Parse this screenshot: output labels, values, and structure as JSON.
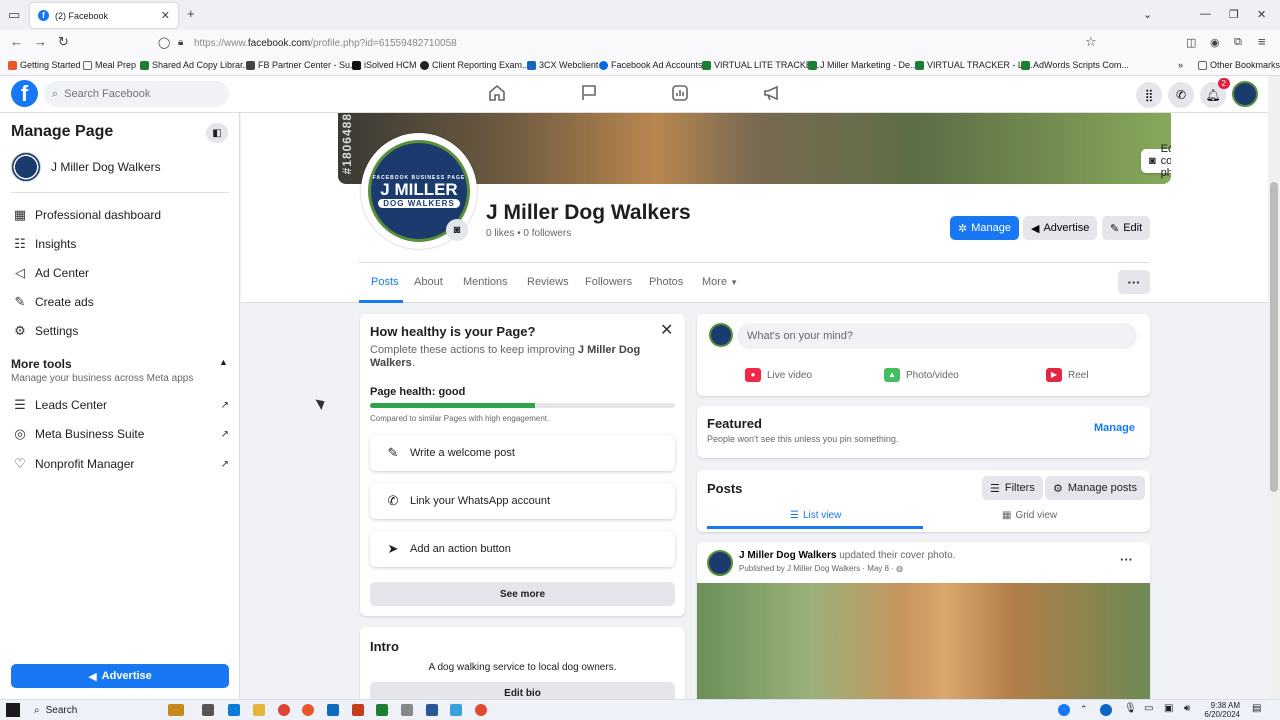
{
  "browser": {
    "tab_title": "(2) Facebook",
    "url_prefix": "https://www.",
    "url_domain": "facebook.com",
    "url_path": "/profile.php?id=61559482710058",
    "bookmarks": [
      "Getting Started",
      "Meal Prep",
      "Shared Ad Copy Librar...",
      "FB Partner Center - Su...",
      "iSolved HCM",
      "Client Reporting Exam...",
      "3CX Webclient",
      "Facebook Ad Accounts",
      "VIRTUAL LITE TRACKE...",
      "J Miller Marketing - De...",
      "VIRTUAL TRACKER - Li...",
      "AdWords Scripts Com..."
    ],
    "other_bookmarks": "Other Bookmarks"
  },
  "fb": {
    "search_placeholder": "Search Facebook",
    "notif_count": "2"
  },
  "sidebar": {
    "title": "Manage Page",
    "page_name": "J Miller Dog Walkers",
    "items": [
      {
        "label": "Professional dashboard"
      },
      {
        "label": "Insights"
      },
      {
        "label": "Ad Center"
      },
      {
        "label": "Create ads"
      },
      {
        "label": "Settings"
      }
    ],
    "more_tools_title": "More tools",
    "more_tools_sub": "Manage your business across Meta apps",
    "tools": [
      {
        "label": "Leads Center"
      },
      {
        "label": "Meta Business Suite"
      },
      {
        "label": "Nonprofit Manager"
      }
    ],
    "advertise": "Advertise"
  },
  "profile": {
    "cover_stamp": "#1806488",
    "edit_cover": "Edit cover photo",
    "logo_ring": "FACEBOOK BUSINESS PAGE",
    "logo_big": "J MILLER",
    "logo_sub": "DOG WALKERS",
    "name": "J Miller Dog Walkers",
    "stats": "0 likes • 0 followers",
    "manage": "Manage",
    "advertise": "Advertise",
    "edit": "Edit",
    "tabs": [
      "Posts",
      "About",
      "Mentions",
      "Reviews",
      "Followers",
      "Photos",
      "More"
    ]
  },
  "health": {
    "title": "How healthy is your Page?",
    "desc_prefix": "Complete these actions to keep improving ",
    "desc_page": "J Miller Dog Walkers",
    "desc_suffix": ".",
    "label": "Page health: good",
    "progress": 0.54,
    "note": "Compared to similar Pages with high engagement.",
    "actions": [
      "Write a welcome post",
      "Link your WhatsApp account",
      "Add an action button"
    ],
    "see_more": "See more"
  },
  "intro": {
    "title": "Intro",
    "text": "A dog walking service to local dog owners.",
    "edit_bio": "Edit bio"
  },
  "composer": {
    "placeholder": "What's on your mind?",
    "live": "Live video",
    "photo": "Photo/video",
    "reel": "Reel"
  },
  "featured": {
    "title": "Featured",
    "sub": "People won't see this unless you pin something.",
    "manage": "Manage"
  },
  "posts": {
    "title": "Posts",
    "filters": "Filters",
    "manage_posts": "Manage posts",
    "list_view": "List view",
    "grid_view": "Grid view"
  },
  "post": {
    "author": "J Miller Dog Walkers",
    "action": " updated their cover photo.",
    "meta": "Published by J Miller Dog Walkers · May 8 ·"
  },
  "taskbar": {
    "search": "Search",
    "time": "9:38 AM",
    "date": "6/20/2024"
  }
}
